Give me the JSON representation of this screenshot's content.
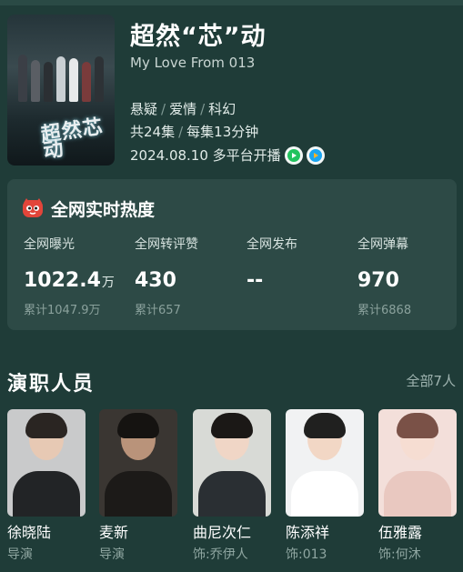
{
  "show": {
    "title": "超然“芯”动",
    "subtitle": "My Love From 013",
    "poster_text": "超然芯动",
    "tags": [
      "悬疑",
      "爱情",
      "科幻"
    ],
    "episodes": "共24集",
    "duration": "每集13分钟",
    "release": "2024.08.10 多平台开播",
    "platform_icons": [
      "iqiyi-play-icon",
      "youku-play-icon"
    ]
  },
  "heat": {
    "title": "全网实时热度",
    "icon": "hot-cat-icon",
    "metrics": [
      {
        "label": "全网曝光",
        "value": "1022.4",
        "unit": "万",
        "total": "累计1047.9万"
      },
      {
        "label": "全网转评赞",
        "value": "430",
        "unit": "",
        "total": "累计657"
      },
      {
        "label": "全网发布",
        "value": "--",
        "unit": "",
        "total": ""
      },
      {
        "label": "全网弹幕",
        "value": "970",
        "unit": "",
        "total": "累计6868"
      }
    ]
  },
  "cast": {
    "title": "演职人员",
    "all": "全部7人",
    "members": [
      {
        "name": "徐晓陆",
        "role": "导演"
      },
      {
        "name": "麦新",
        "role": "导演"
      },
      {
        "name": "曲尼次仁",
        "role": "饰:乔伊人"
      },
      {
        "name": "陈添祥",
        "role": "饰:013"
      },
      {
        "name": "伍雅露",
        "role": "饰:何沐"
      }
    ]
  },
  "colors": {
    "background": "#1f3c38",
    "panel": "#2d4a46",
    "accent_red": "#e2453a"
  }
}
